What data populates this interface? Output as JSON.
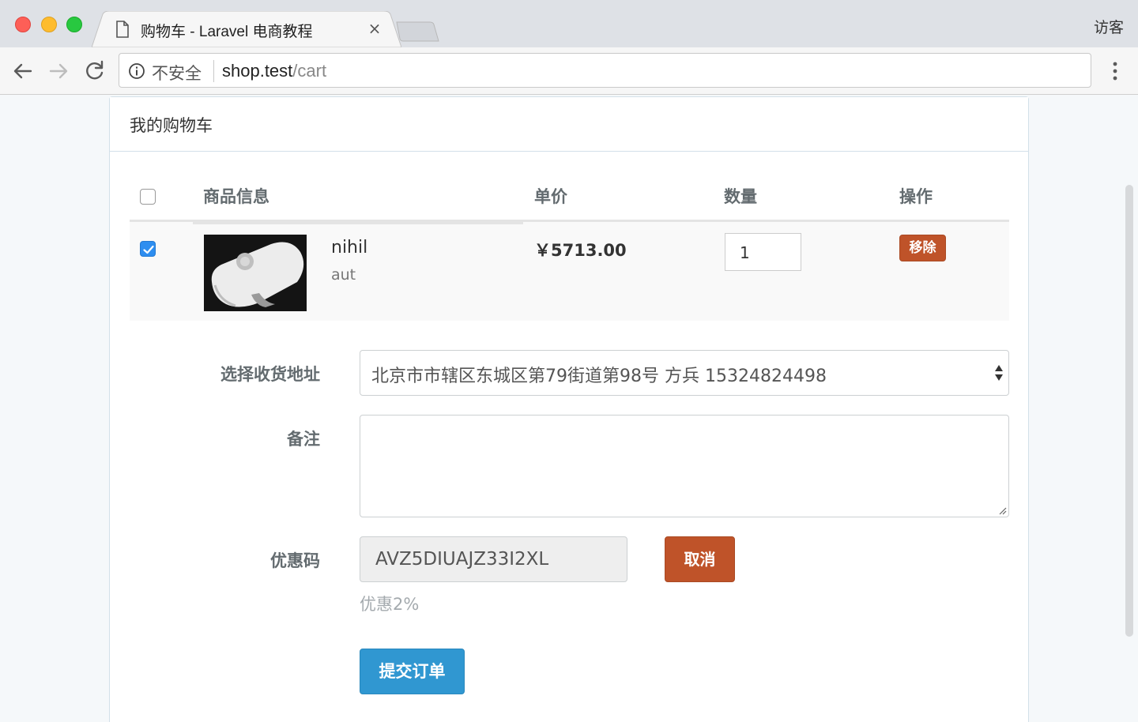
{
  "browser": {
    "tab_title": "购物车 - Laravel 电商教程",
    "tab_close": "×",
    "guest_label": "访客",
    "security_label": "不安全",
    "url_host": "shop.test",
    "url_path": "/cart"
  },
  "cart": {
    "panel_title": "我的购物车",
    "columns": {
      "product": "商品信息",
      "price": "单价",
      "quantity": "数量",
      "action": "操作"
    },
    "items": [
      {
        "title": "nihil",
        "sku": "aut",
        "price": "￥5713.00",
        "quantity": "1",
        "remove_label": "移除",
        "checked": true
      }
    ]
  },
  "form": {
    "address_label": "选择收货地址",
    "address_value": "北京市市辖区东城区第79街道第98号 方兵 15324824498",
    "remark_label": "备注",
    "remark_value": "",
    "coupon_label": "优惠码",
    "coupon_value": "AVZ5DIUAJZ33I2XL",
    "coupon_cancel": "取消",
    "coupon_note": "优惠2%",
    "submit_label": "提交订单"
  },
  "colors": {
    "danger": "#bf5329",
    "primary": "#3097d1",
    "checkbox_checked": "#2e8ef0"
  },
  "icons": [
    "document-icon",
    "close-icon",
    "back-arrow-icon",
    "forward-arrow-icon",
    "reload-icon",
    "info-icon",
    "menu-dots-icon",
    "select-arrows-icon",
    "resize-grip-icon"
  ]
}
